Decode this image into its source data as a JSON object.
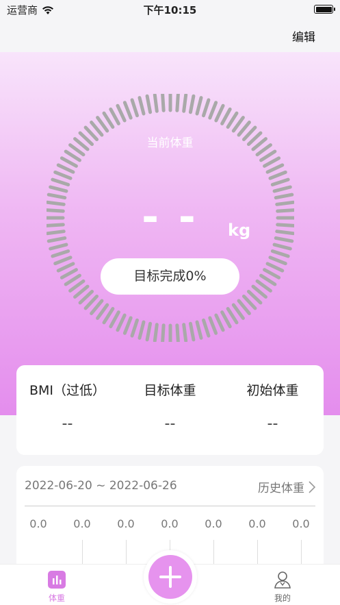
{
  "status_bar": {
    "carrier": "运营商",
    "time": "下午10:15"
  },
  "nav": {
    "edit_label": "编辑"
  },
  "gauge": {
    "label": "当前体重",
    "value": "- -",
    "unit": "kg",
    "progress_text": "目标完成0%",
    "progress_fraction": 0,
    "tick_color": "#a9a9a9"
  },
  "stats": {
    "bmi": {
      "label": "BMI（过低）",
      "value": "--"
    },
    "target": {
      "label": "目标体重",
      "value": "--"
    },
    "initial": {
      "label": "初始体重",
      "value": "--"
    }
  },
  "history": {
    "date_range": "2022-06-20 ~ 2022-06-26",
    "link_label": "历史体重",
    "values": [
      "0.0",
      "0.0",
      "0.0",
      "0.0",
      "0.0",
      "0.0",
      "0.0"
    ]
  },
  "tabs": {
    "weight_label": "体重",
    "mine_label": "我的"
  },
  "colors": {
    "accent": "#e693ee",
    "active_tab": "#d87be3"
  }
}
